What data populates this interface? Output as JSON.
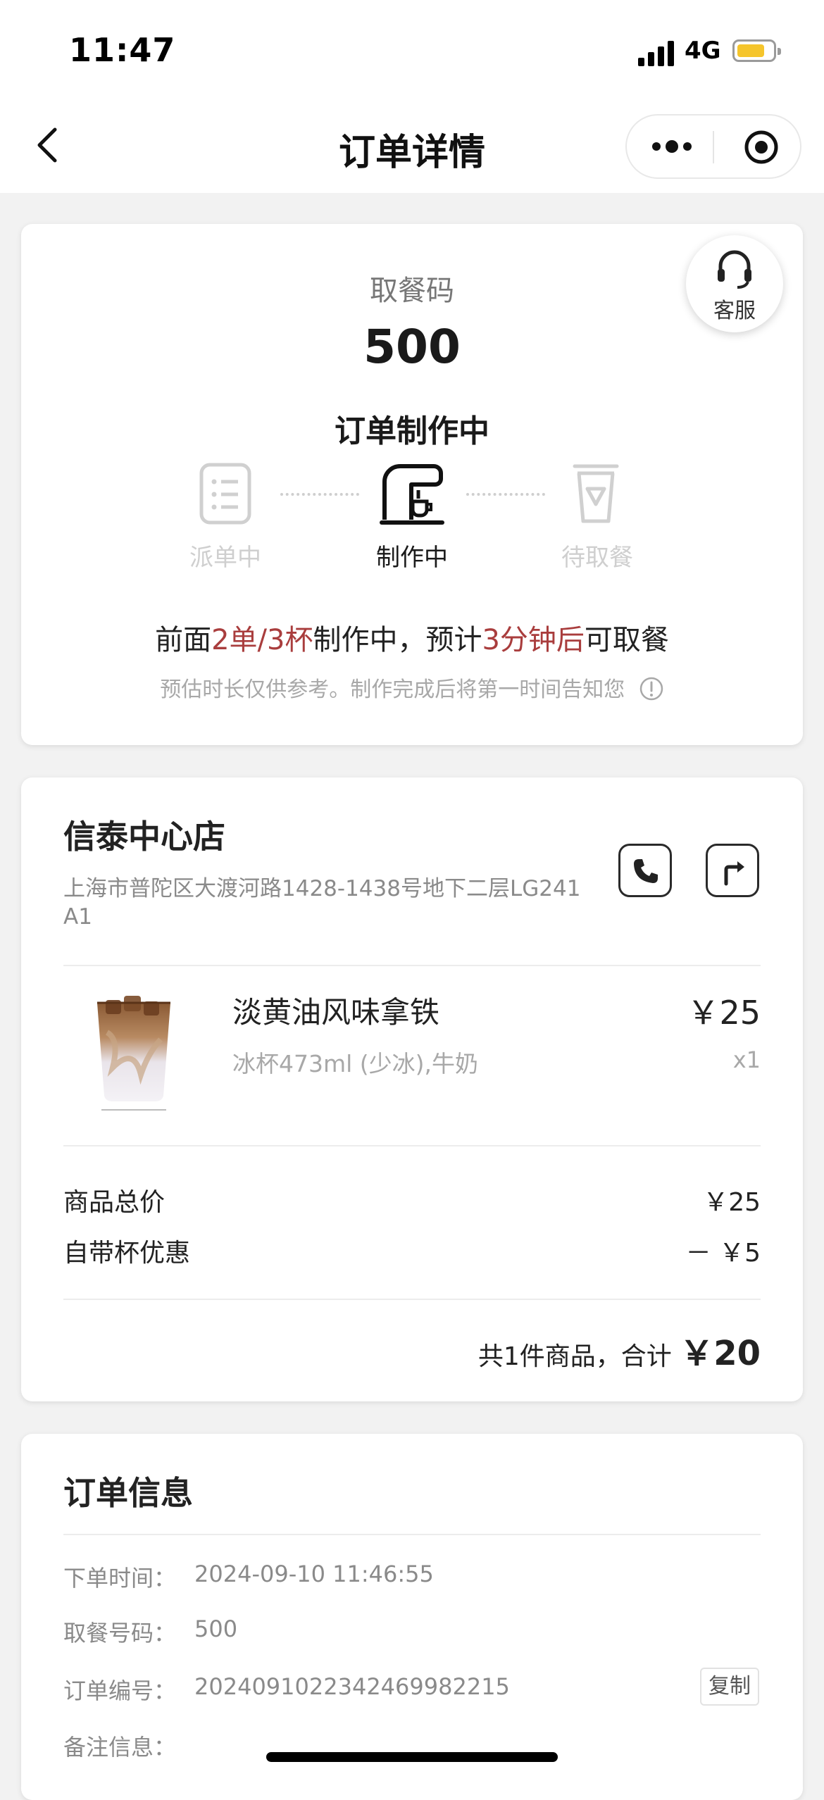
{
  "status_bar": {
    "time": "11:47",
    "network": "4G"
  },
  "nav": {
    "title": "订单详情"
  },
  "pickup": {
    "label": "取餐码",
    "code": "500",
    "status_title": "订单制作中",
    "customer_service": "客服",
    "steps": [
      {
        "label": "派单中",
        "state": "done"
      },
      {
        "label": "制作中",
        "state": "active"
      },
      {
        "label": "待取餐",
        "state": "pending"
      }
    ],
    "queue": {
      "prefix": "前面",
      "orders": "2单/3杯",
      "middle": "制作中，预计",
      "eta": "3分钟后",
      "suffix": "可取餐"
    },
    "note": "预估时长仅供参考。制作完成后将第一时间告知您"
  },
  "store": {
    "name": "信泰中心店",
    "address_line1": "上海市普陀区大渡河路1428-1438号地下二层LG241",
    "address_line2": "A1"
  },
  "item": {
    "name": "淡黄油风味拿铁",
    "options": "冰杯473ml (少冰),牛奶",
    "price": "￥25",
    "qty": "x1"
  },
  "summary": {
    "subtotal_label": "商品总价",
    "subtotal_value": "￥25",
    "discount_label": "自带杯优惠",
    "discount_value": "－ ￥5",
    "total_prefix": "共1件商品，合计",
    "total_value": "￥20"
  },
  "order_info": {
    "title": "订单信息",
    "rows": [
      {
        "label": "下单时间：",
        "value": "2024-09-10 11:46:55"
      },
      {
        "label": "取餐号码：",
        "value": "500"
      },
      {
        "label": "订单编号：",
        "value": "2024091022342469982215"
      },
      {
        "label": "备注信息：",
        "value": ""
      }
    ],
    "copy_label": "复制"
  },
  "colors": {
    "accent_red": "#a93d3d",
    "battery": "#f5c52c"
  }
}
